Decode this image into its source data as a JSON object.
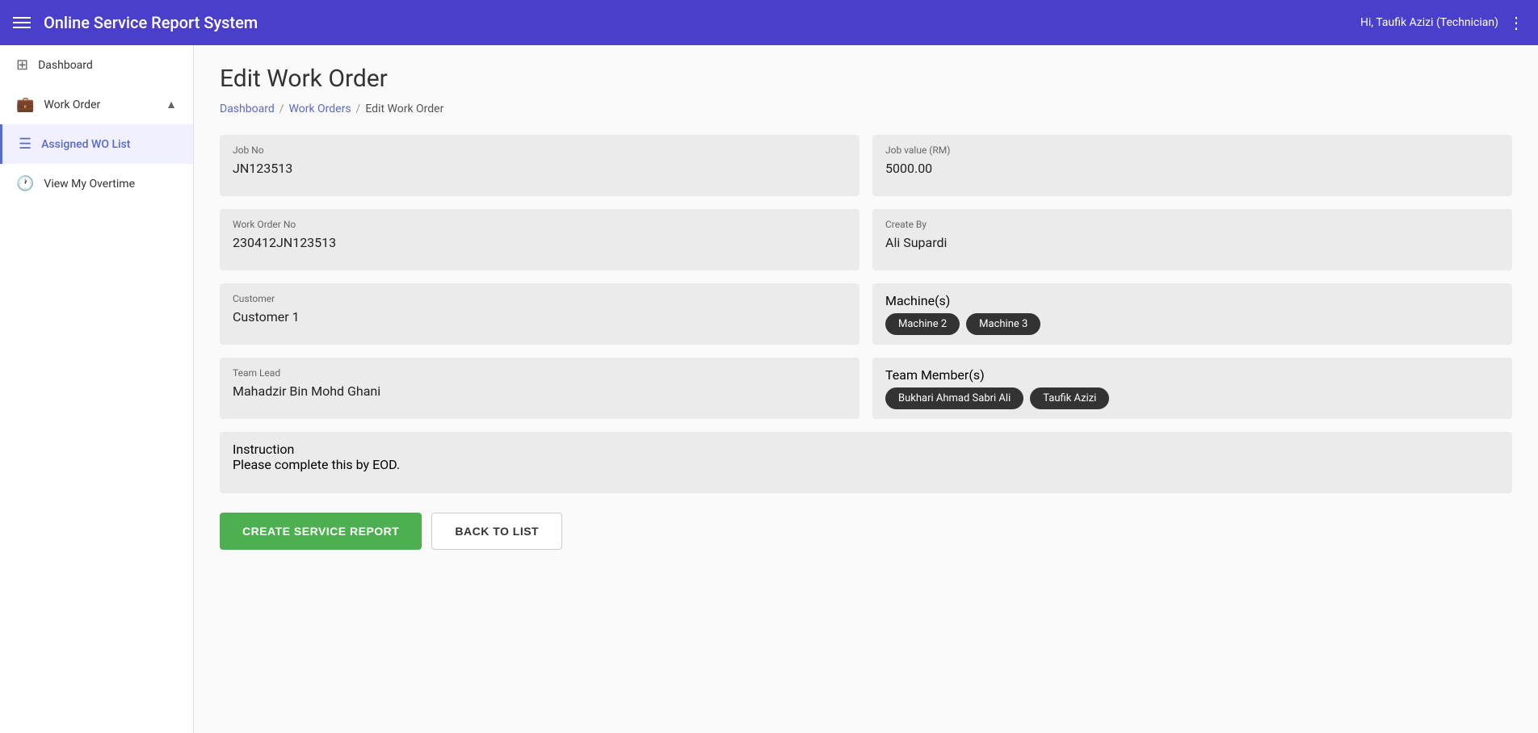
{
  "topbar": {
    "title": "Online Service Report System",
    "user_greeting": "Hi, Taufik Azizi (Technician)"
  },
  "sidebar": {
    "dashboard_label": "Dashboard",
    "work_order_label": "Work Order",
    "assigned_wo_label": "Assigned WO List",
    "view_overtime_label": "View My Overtime"
  },
  "breadcrumb": {
    "dashboard": "Dashboard",
    "work_orders": "Work Orders",
    "current": "Edit Work Order"
  },
  "page": {
    "title": "Edit Work Order"
  },
  "fields": {
    "job_no_label": "Job No",
    "job_no_value": "JN123513",
    "job_value_label": "Job value (RM)",
    "job_value_value": "5000.00",
    "work_order_no_label": "Work Order No",
    "work_order_no_value": "230412JN123513",
    "create_by_label": "Create By",
    "create_by_value": "Ali Supardi",
    "customer_label": "Customer",
    "customer_value": "Customer 1",
    "machines_label": "Machine(s)",
    "machines": [
      "Machine 2",
      "Machine 3"
    ],
    "team_lead_label": "Team Lead",
    "team_lead_value": "Mahadzir Bin Mohd Ghani",
    "team_members_label": "Team Member(s)",
    "team_members": [
      "Bukhari Ahmad Sabri Ali",
      "Taufik Azizi"
    ],
    "instruction_label": "Instruction",
    "instruction_value": "Please complete this by EOD."
  },
  "buttons": {
    "create_report": "CREATE SERVICE REPORT",
    "back_to_list": "BACK TO LIST"
  }
}
